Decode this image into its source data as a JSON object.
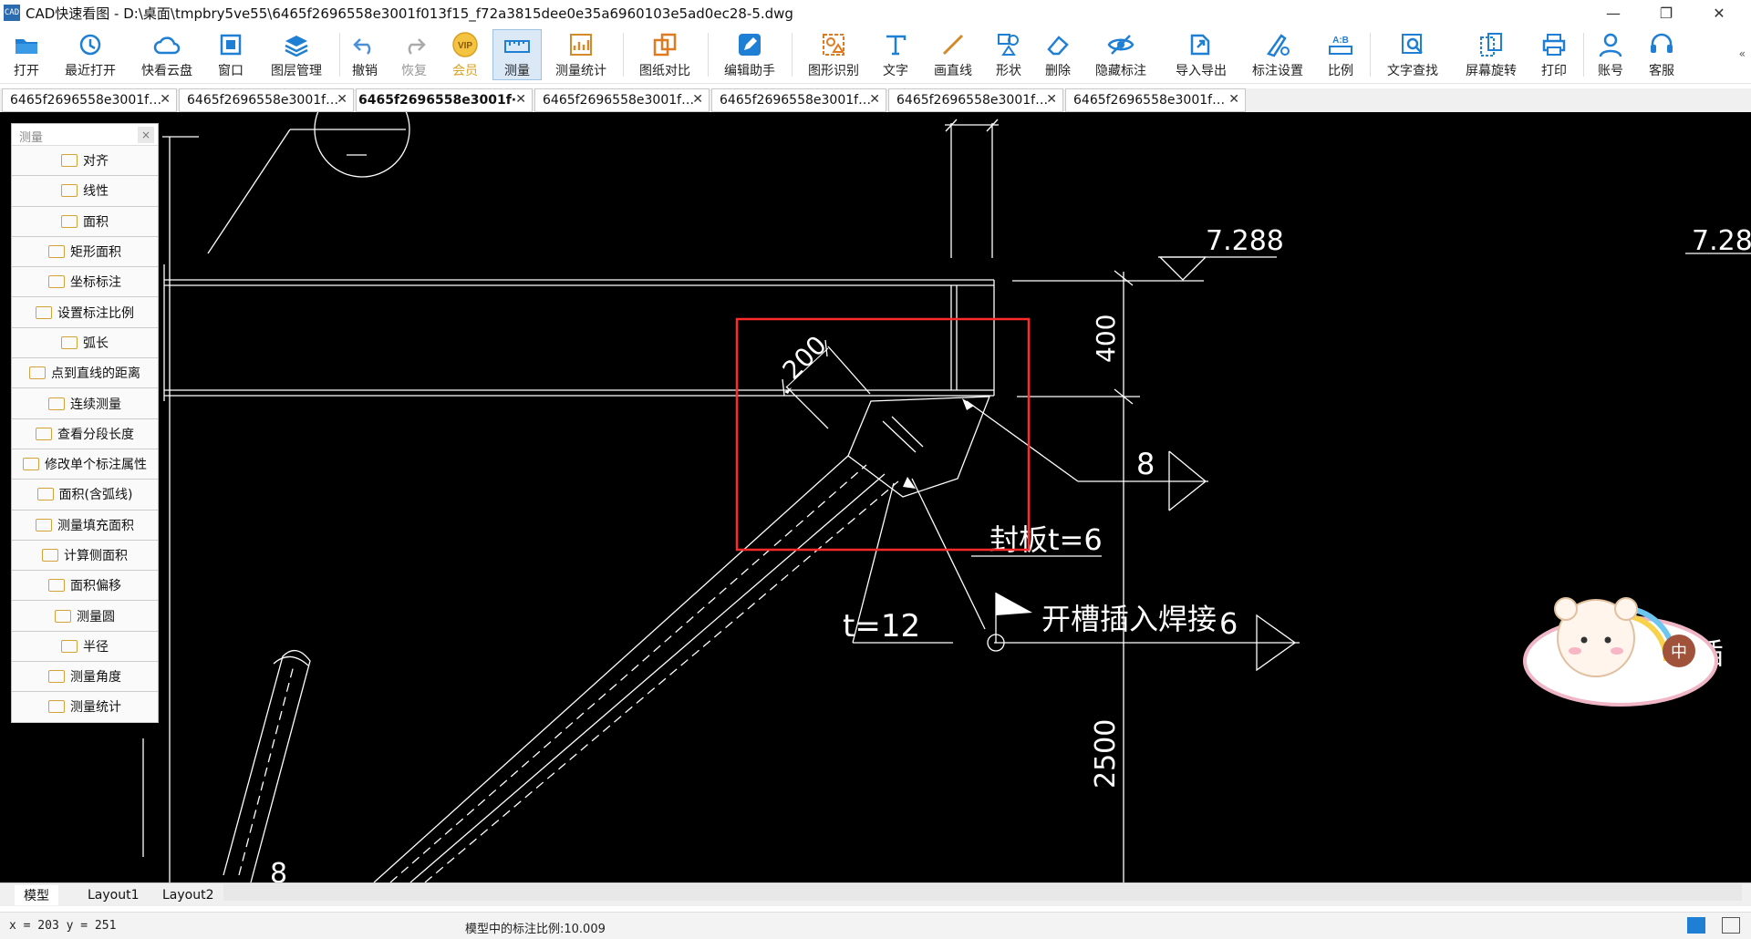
{
  "window": {
    "app_icon": "CAD",
    "title": "CAD快速看图 - D:\\桌面\\tmpbry5ve55\\6465f2696558e3001f013f15_f72a3815dee0e35a6960103e5ad0ec28-5.dwg",
    "minimize": "—",
    "restore": "❐",
    "close": "✕"
  },
  "toolbar": {
    "items": [
      {
        "label": "打开",
        "icon": "folder-icon"
      },
      {
        "label": "最近打开",
        "icon": "recent-icon"
      },
      {
        "label": "快看云盘",
        "icon": "cloud-icon"
      },
      {
        "label": "窗口",
        "icon": "window-icon"
      },
      {
        "label": "图层管理",
        "icon": "layers-icon"
      },
      {
        "label": "撤销",
        "icon": "undo-icon"
      },
      {
        "label": "恢复",
        "icon": "redo-icon"
      },
      {
        "label": "会员",
        "icon": "vip-icon"
      },
      {
        "label": "测量",
        "icon": "measure-icon"
      },
      {
        "label": "测量统计",
        "icon": "measure-stats-icon"
      },
      {
        "label": "图纸对比",
        "icon": "compare-icon"
      },
      {
        "label": "编辑助手",
        "icon": "edit-assistant-icon"
      },
      {
        "label": "图形识别",
        "icon": "shape-recognition-icon"
      },
      {
        "label": "文字",
        "icon": "text-icon"
      },
      {
        "label": "画直线",
        "icon": "line-icon"
      },
      {
        "label": "形状",
        "icon": "shape-icon"
      },
      {
        "label": "删除",
        "icon": "eraser-icon"
      },
      {
        "label": "隐藏标注",
        "icon": "hide-annotation-icon"
      },
      {
        "label": "导入导出",
        "icon": "import-export-icon"
      },
      {
        "label": "标注设置",
        "icon": "annotation-settings-icon"
      },
      {
        "label": "比例",
        "icon": "scale-icon"
      },
      {
        "label": "文字查找",
        "icon": "text-search-icon"
      },
      {
        "label": "屏幕旋转",
        "icon": "rotate-screen-icon"
      },
      {
        "label": "打印",
        "icon": "print-icon"
      },
      {
        "label": "账号",
        "icon": "account-icon"
      },
      {
        "label": "客服",
        "icon": "support-icon"
      }
    ],
    "vip_badge": "VIP",
    "scale_badge": "A:B",
    "more": "«"
  },
  "tabs": [
    {
      "label": "6465f2696558e3001f…",
      "active": false
    },
    {
      "label": "6465f2696558e3001f…",
      "active": false
    },
    {
      "label": "6465f2696558e3001f·",
      "active": true
    },
    {
      "label": "6465f2696558e3001f…",
      "active": false
    },
    {
      "label": "6465f2696558e3001f…",
      "active": false
    },
    {
      "label": "6465f2696558e3001f…",
      "active": false
    },
    {
      "label": "6465f2696558e3001f…",
      "active": false
    }
  ],
  "tab_close": "✕",
  "measure_panel": {
    "title": "测量",
    "close": "×",
    "items": [
      "对齐",
      "线性",
      "面积",
      "矩形面积",
      "坐标标注",
      "设置标注比例",
      "弧长",
      "点到直线的距离",
      "连续测量",
      "查看分段长度",
      "修改单个标注属性",
      "面积(含弧线)",
      "测量填充面积",
      "计算侧面积",
      "面积偏移",
      "测量圆",
      "半径",
      "测量角度",
      "测量统计"
    ]
  },
  "drawing": {
    "elev_1": "7.288",
    "elev_2": "7.28",
    "dim_400": "400",
    "dim_200": "200",
    "dim_2500": "2500",
    "weld_8": "8",
    "weld_6": "6",
    "plate_label": "封板t=6",
    "t12": "t=12",
    "slot_weld": "开槽插入焊接",
    "edge_text": "插",
    "bottom_8": "8",
    "highlight_color": "#ff2a2a"
  },
  "layouts": [
    "模型",
    "Layout1",
    "Layout2"
  ],
  "status": {
    "coords": "x = 203  y = 251",
    "scale_text": "模型中的标注比例:10.009"
  },
  "mascot": {
    "badge": "中"
  }
}
